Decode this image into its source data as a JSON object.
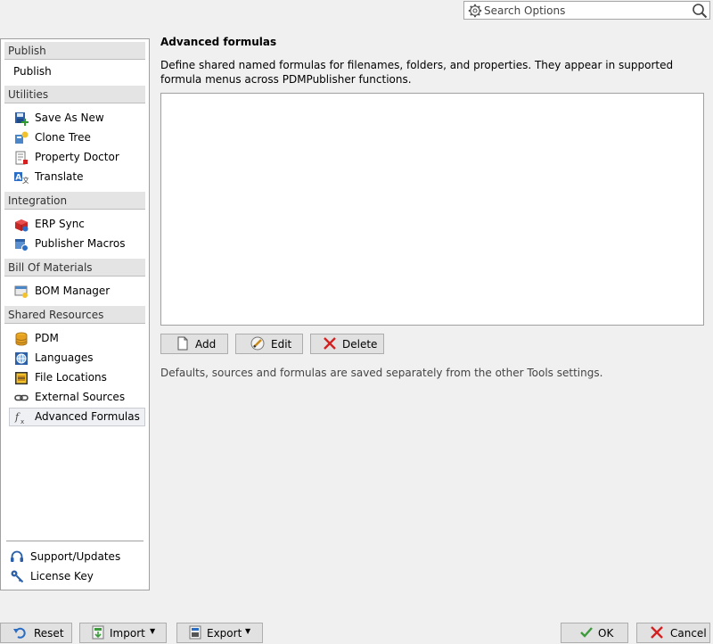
{
  "search": {
    "placeholder": "Search Options",
    "gear_icon": "gear-icon",
    "magnifier_icon": "search-icon"
  },
  "sidebar": {
    "groups": [
      {
        "title": "Publish",
        "items": [
          {
            "label": "Publish"
          }
        ]
      },
      {
        "title": "Utilities",
        "items": [
          {
            "label": "Save As New",
            "icon": "save-as-new-icon"
          },
          {
            "label": "Clone Tree",
            "icon": "clone-tree-icon"
          },
          {
            "label": "Property Doctor",
            "icon": "property-doctor-icon"
          },
          {
            "label": "Translate",
            "icon": "translate-icon"
          }
        ]
      },
      {
        "title": "Integration",
        "items": [
          {
            "label": "ERP Sync",
            "icon": "erp-sync-icon"
          },
          {
            "label": "Publisher Macros",
            "icon": "publisher-macros-icon"
          }
        ]
      },
      {
        "title": "Bill Of Materials",
        "items": [
          {
            "label": "BOM Manager",
            "icon": "bom-manager-icon"
          }
        ]
      },
      {
        "title": "Shared Resources",
        "items": [
          {
            "label": "PDM",
            "icon": "database-icon"
          },
          {
            "label": "Languages",
            "icon": "languages-icon"
          },
          {
            "label": "File Locations",
            "icon": "file-locations-icon"
          },
          {
            "label": "External Sources",
            "icon": "link-icon"
          },
          {
            "label": "Advanced Formulas",
            "icon": "formula-icon",
            "selected": true
          }
        ]
      }
    ],
    "footer": [
      {
        "label": "Support/Updates",
        "icon": "headset-icon"
      },
      {
        "label": "License Key",
        "icon": "key-icon"
      }
    ]
  },
  "panel": {
    "title": "Advanced formulas",
    "description": "Define shared named formulas for filenames, folders, and properties. They appear in supported formula menus across PDMPublisher functions.",
    "buttons": {
      "add": "Add",
      "edit": "Edit",
      "delete": "Delete"
    },
    "note": "Defaults, sources and formulas are saved separately from the other Tools settings."
  },
  "footer_bar": {
    "reset": "Reset",
    "import": "Import",
    "export": "Export",
    "ok": "OK",
    "cancel": "Cancel"
  },
  "colors": {
    "accent_red": "#d32020",
    "accent_green": "#3c9a3c",
    "accent_blue": "#2b6cc4"
  }
}
